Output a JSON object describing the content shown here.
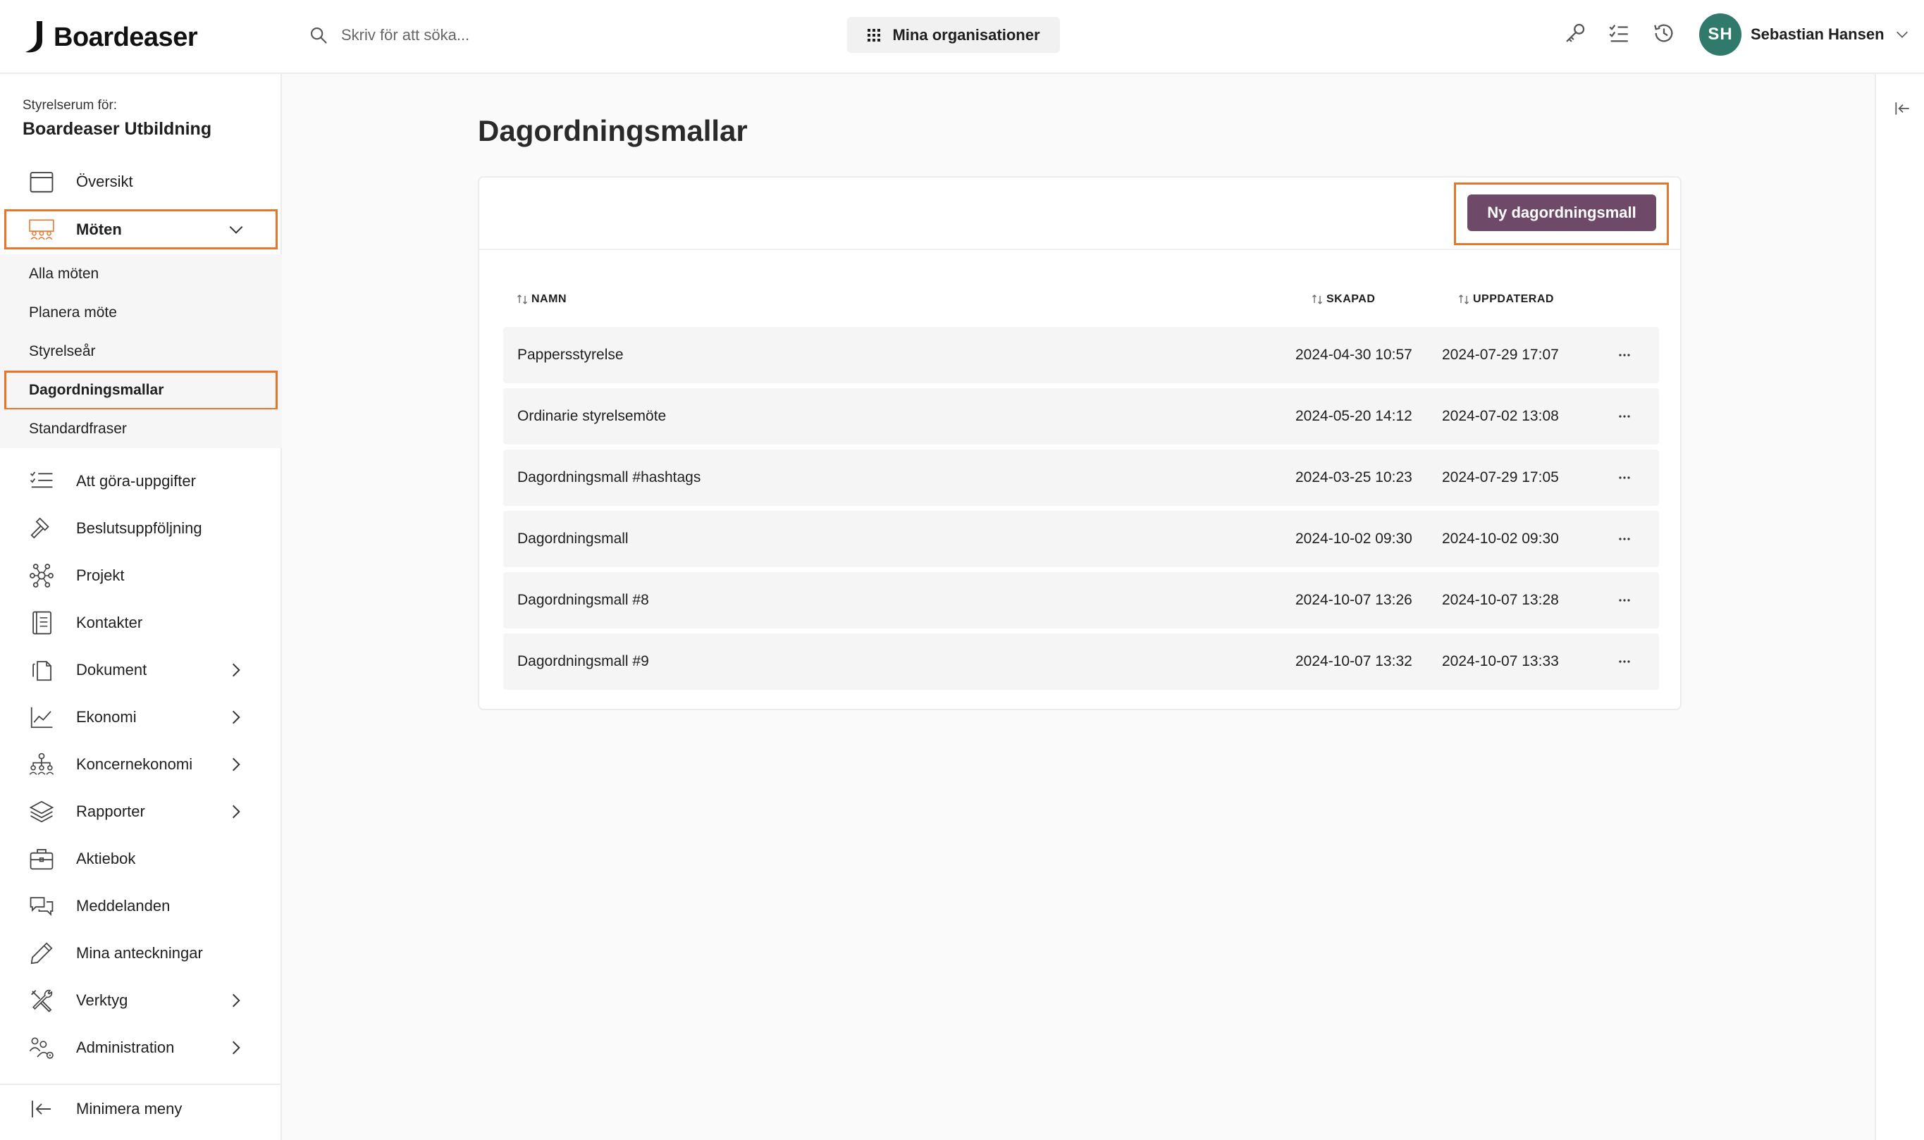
{
  "brand": {
    "name": "Boardeaser"
  },
  "search": {
    "placeholder": "Skriv för att söka..."
  },
  "org_button": {
    "label": "Mina organisationer"
  },
  "user": {
    "initials": "SH",
    "name": "Sebastian Hansen",
    "avatar_color": "#2f7a6b"
  },
  "sidebar": {
    "room_label": "Styrelserum för:",
    "room_name": "Boardeaser Utbildning",
    "items": [
      {
        "label": "Översikt",
        "icon": "calendar-icon"
      },
      {
        "label": "Möten",
        "icon": "meeting-icon",
        "expanded": true
      },
      {
        "label": "Att göra-uppgifter",
        "icon": "checklist-icon"
      },
      {
        "label": "Beslutsuppföljning",
        "icon": "gavel-icon"
      },
      {
        "label": "Projekt",
        "icon": "network-icon"
      },
      {
        "label": "Kontakter",
        "icon": "address-book-icon"
      },
      {
        "label": "Dokument",
        "icon": "documents-icon"
      },
      {
        "label": "Ekonomi",
        "icon": "line-chart-icon"
      },
      {
        "label": "Koncernekonomi",
        "icon": "org-chart-icon"
      },
      {
        "label": "Rapporter",
        "icon": "layers-icon"
      },
      {
        "label": "Aktiebok",
        "icon": "briefcase-icon"
      },
      {
        "label": "Meddelanden",
        "icon": "chat-bubbles-icon"
      },
      {
        "label": "Mina anteckningar",
        "icon": "pencil-icon"
      },
      {
        "label": "Verktyg",
        "icon": "tools-icon"
      },
      {
        "label": "Administration",
        "icon": "users-gear-icon"
      }
    ],
    "meetings_sub": [
      {
        "label": "Alla möten"
      },
      {
        "label": "Planera möte"
      },
      {
        "label": "Styrelseår"
      },
      {
        "label": "Dagordningsmallar"
      },
      {
        "label": "Standardfraser"
      }
    ],
    "minimize_label": "Minimera meny"
  },
  "main": {
    "title": "Dagordningsmallar",
    "new_button": "Ny dagordningsmall",
    "columns": {
      "name": "NAMN",
      "created": "SKAPAD",
      "updated": "UPPDATERAD"
    },
    "rows": [
      {
        "name": "Pappersstyrelse",
        "created": "2024-04-30 10:57",
        "updated": "2024-07-29 17:07"
      },
      {
        "name": "Ordinarie styrelsemöte",
        "created": "2024-05-20 14:12",
        "updated": "2024-07-02 13:08"
      },
      {
        "name": "Dagordningsmall #hashtags",
        "created": "2024-03-25 10:23",
        "updated": "2024-07-29 17:05"
      },
      {
        "name": "Dagordningsmall",
        "created": "2024-10-02 09:30",
        "updated": "2024-10-02 09:30"
      },
      {
        "name": "Dagordningsmall #8",
        "created": "2024-10-07 13:26",
        "updated": "2024-10-07 13:28"
      },
      {
        "name": "Dagordningsmall #9",
        "created": "2024-10-07 13:32",
        "updated": "2024-10-07 13:33"
      }
    ]
  },
  "colors": {
    "primary_button": "#6e4a68",
    "highlight": "#e8752a",
    "meeting_icon": "#e8752a"
  }
}
